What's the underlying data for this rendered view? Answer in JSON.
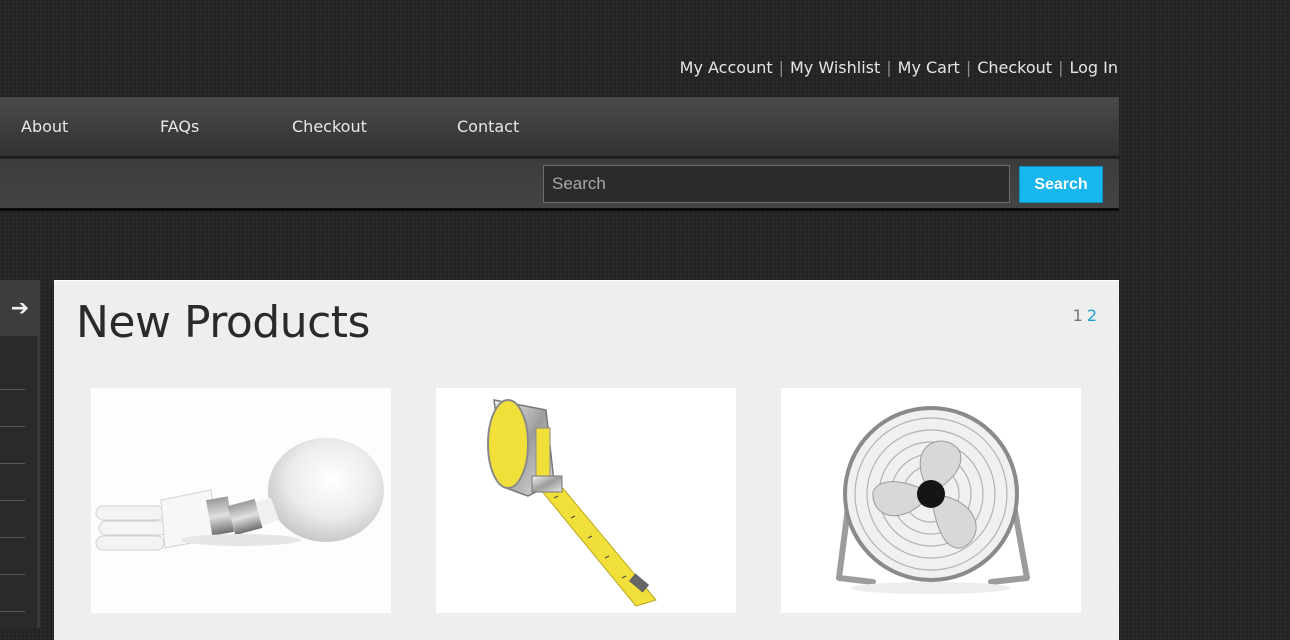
{
  "header": {
    "links": [
      "My Account",
      "My Wishlist",
      "My Cart",
      "Checkout",
      "Log In"
    ]
  },
  "nav": {
    "items": [
      "About",
      "FAQs",
      "Checkout",
      "Contact"
    ]
  },
  "search": {
    "placeholder": "Search",
    "button_label": "Search"
  },
  "sidebar": {
    "toggle_icon": "arrow-right-icon",
    "toggle_glyph": "➔"
  },
  "new_products": {
    "title": "New Products",
    "pager": {
      "current": "1",
      "next": "2"
    },
    "items": [
      {
        "image": "light-bulb-image",
        "name": ""
      },
      {
        "image": "tape-measure-image",
        "name": ""
      },
      {
        "image": "floor-fan-image",
        "name": ""
      }
    ]
  },
  "colors": {
    "accent": "#16b6ee",
    "link": "#1a9fd6",
    "tape_yellow": "#f2e03a"
  }
}
